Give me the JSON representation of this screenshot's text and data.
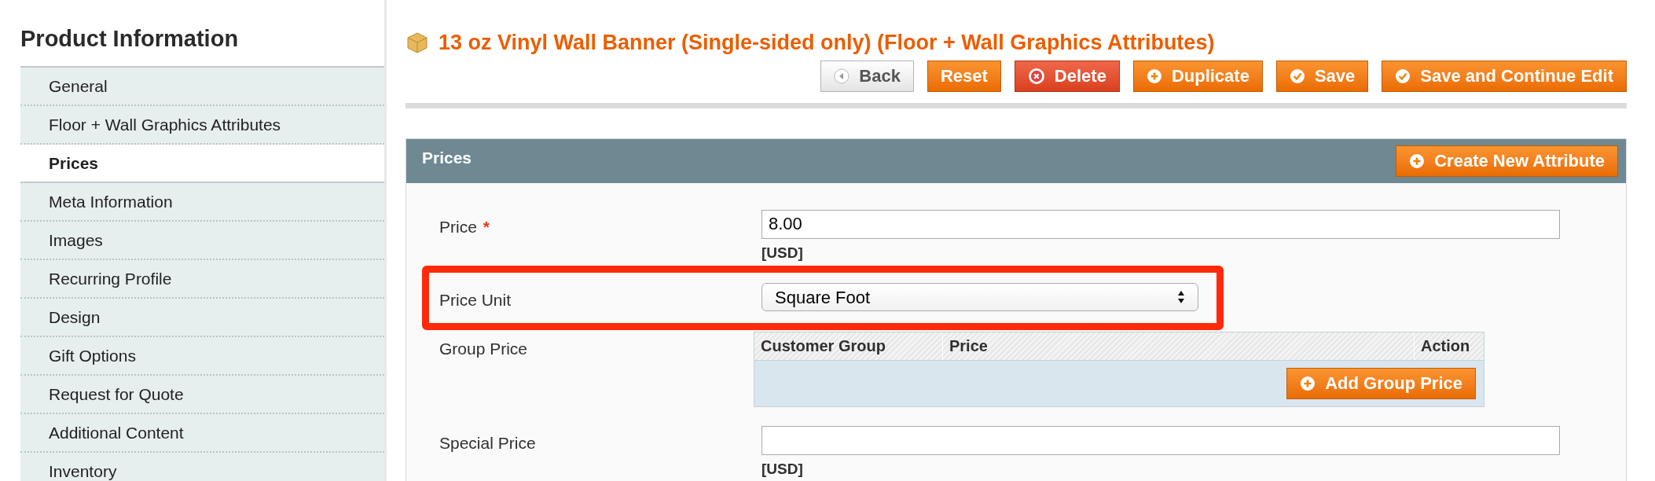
{
  "sidebar": {
    "title": "Product Information",
    "items": [
      {
        "label": "General",
        "selected": false
      },
      {
        "label": "Floor + Wall Graphics Attributes",
        "selected": false
      },
      {
        "label": "Prices",
        "selected": true
      },
      {
        "label": "Meta Information",
        "selected": false
      },
      {
        "label": "Images",
        "selected": false
      },
      {
        "label": "Recurring Profile",
        "selected": false
      },
      {
        "label": "Design",
        "selected": false
      },
      {
        "label": "Gift Options",
        "selected": false
      },
      {
        "label": "Request for Quote",
        "selected": false
      },
      {
        "label": "Additional Content",
        "selected": false
      },
      {
        "label": "Inventory",
        "selected": false
      }
    ]
  },
  "page_title": "13 oz Vinyl Wall Banner (Single-sided only) (Floor + Wall Graphics Attributes)",
  "toolbar": [
    {
      "label": "Back",
      "kind": "back"
    },
    {
      "label": "Reset",
      "kind": "plain"
    },
    {
      "label": "Delete",
      "kind": "delete"
    },
    {
      "label": "Duplicate",
      "kind": "add"
    },
    {
      "label": "Save",
      "kind": "save"
    },
    {
      "label": "Save and Continue Edit",
      "kind": "save"
    }
  ],
  "section": {
    "title": "Prices",
    "action": "Create New Attribute",
    "fields": [
      {
        "kind": "text",
        "label": "Price",
        "required_mark": "*",
        "value": "8.00",
        "note": "[USD]",
        "highlighted": false
      },
      {
        "kind": "select",
        "label": "Price Unit",
        "value": "Square Foot",
        "highlighted": true
      },
      {
        "kind": "table",
        "label": "Group Price",
        "highlighted": false,
        "columns": [
          "Customer Group",
          "Price",
          "Action"
        ],
        "button": "Add Group Price"
      },
      {
        "kind": "text",
        "label": "Special Price",
        "note": "[USD]",
        "highlighted": false
      }
    ]
  }
}
